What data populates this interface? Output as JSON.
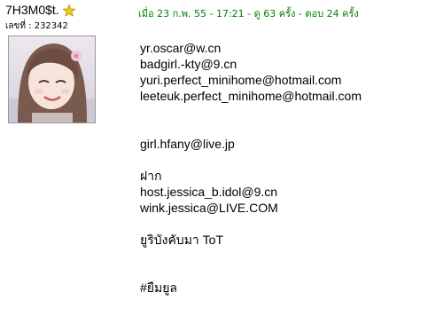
{
  "user": {
    "name": "7H3M0$t.",
    "member_label": "เลขที่ : 232342",
    "rank_icon": "star-icon",
    "avatar_icon": "user-avatar-photo"
  },
  "post": {
    "meta": "เมื่อ 23 ก.พ. 55 - 17:21 - ดู 63 ครั้ง - ตอบ 24 ครั้ง",
    "lines": [
      "yr.oscar@w.cn",
      "badgirl.-kty@9.cn",
      "yuri.perfect_minihome@hotmail.com",
      "leeteuk.perfect_minihome@hotmail.com",
      "girl.hfany@live.jp",
      "ฝาก",
      "host.jessica_b.idol@9.cn",
      "wink.jessica@LIVE.COM",
      "ยูริบังคับมา ToT",
      "#ยืมยูล"
    ]
  },
  "colors": {
    "meta_text": "#008000",
    "star": "#f5d000",
    "avatar_border": "#9a9a9a"
  }
}
